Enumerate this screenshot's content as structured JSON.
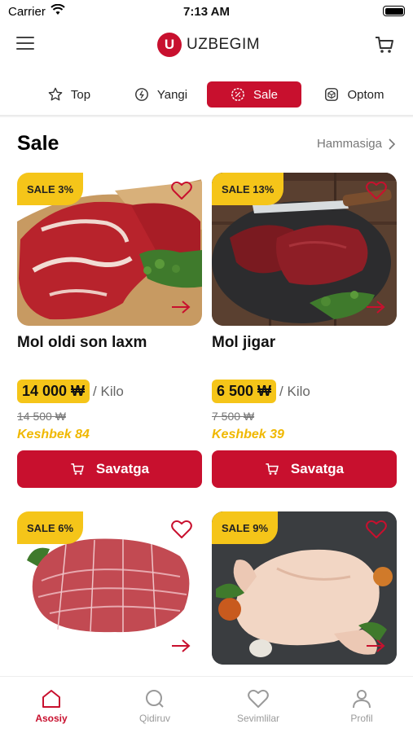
{
  "status_bar": {
    "carrier": "Carrier",
    "time": "7:13 AM"
  },
  "header": {
    "logo_letter": "U",
    "logo_text": "UZBEGIM"
  },
  "tabs": [
    {
      "label": "Top",
      "icon": "star-icon",
      "active": false
    },
    {
      "label": "Yangi",
      "icon": "new-badge-icon",
      "active": false
    },
    {
      "label": "Sale",
      "icon": "discount-icon",
      "active": true
    },
    {
      "label": "Optom",
      "icon": "box-icon",
      "active": false
    }
  ],
  "section": {
    "title": "Sale",
    "see_all": "Hammasiga"
  },
  "products": [
    {
      "badge": "SALE 3%",
      "name": "Mol oldi son laxm",
      "price": "14 000 ₩",
      "unit": "/ Kilo",
      "old_price": "14 500 ₩",
      "cashback": "Keshbek 84",
      "button": "Savatga"
    },
    {
      "badge": "SALE 13%",
      "name": "Mol jigar",
      "price": "6 500 ₩",
      "unit": "/ Kilo",
      "old_price": "7 500 ₩",
      "cashback": "Keshbek 39",
      "button": "Savatga"
    },
    {
      "badge": "SALE 6%"
    },
    {
      "badge": "SALE 9%"
    }
  ],
  "bottom_nav": [
    {
      "label": "Asosiy",
      "icon": "home-icon",
      "active": true
    },
    {
      "label": "Qidiruv",
      "icon": "search-icon",
      "active": false
    },
    {
      "label": "Sevimlilar",
      "icon": "heart-icon",
      "active": false
    },
    {
      "label": "Profil",
      "icon": "user-icon",
      "active": false
    }
  ],
  "colors": {
    "brand_red": "#c8102e",
    "sale_yellow": "#f5c519",
    "cashback_gold": "#f0b800"
  }
}
